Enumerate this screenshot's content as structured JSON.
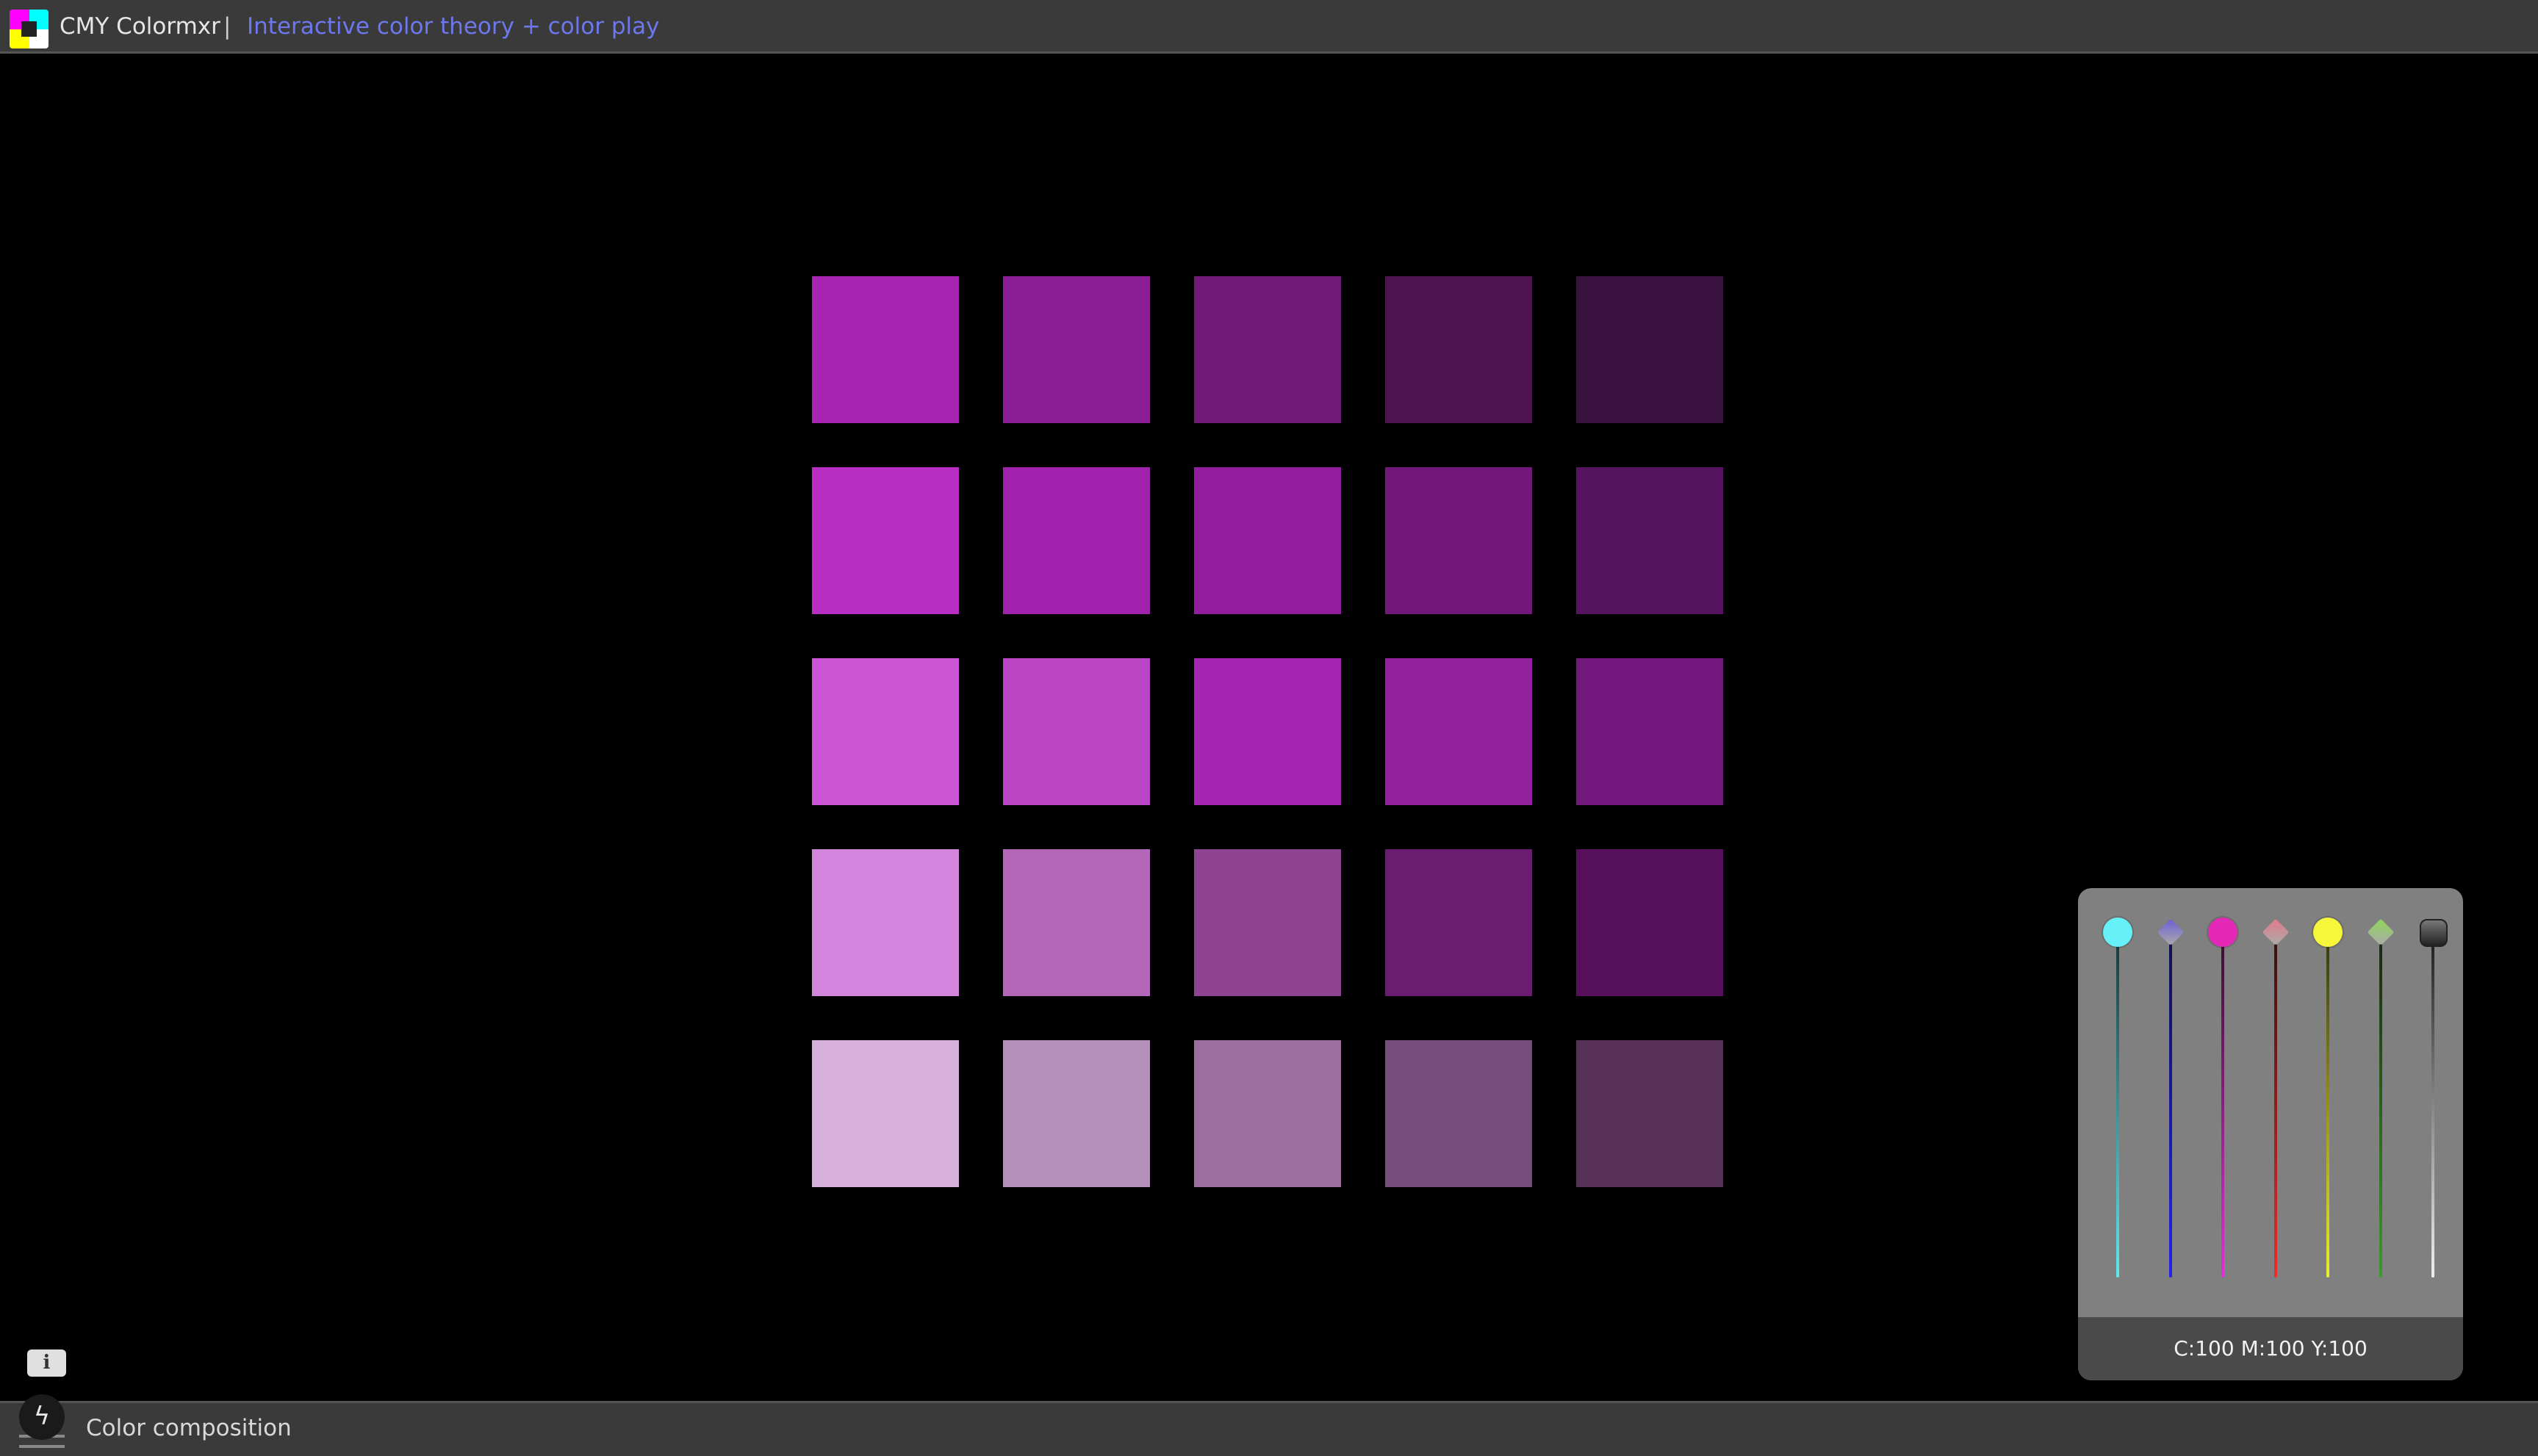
{
  "header": {
    "app_title": "CMY Colormxr",
    "separator": "|",
    "subtitle": "Interactive color theory + color play"
  },
  "swatch_grid": {
    "rows": [
      [
        "#a824b3",
        "#8b1e94",
        "#711a78",
        "#4e1350",
        "#3a1240"
      ],
      [
        "#b82ec2",
        "#a021ac",
        "#921d9f",
        "#72187a",
        "#561460"
      ],
      [
        "#cc55d5",
        "#bb46c5",
        "#a527b1",
        "#93219f",
        "#73187c"
      ],
      [
        "#d385dd",
        "#b466b9",
        "#8e4393",
        "#6a1d70",
        "#560f5b"
      ],
      [
        "#d8b0dc",
        "#b48fba",
        "#9a6e9e",
        "#754d7a",
        "#583159"
      ]
    ]
  },
  "mixer": {
    "sliders": [
      {
        "name": "cyan",
        "knob": "circle",
        "knob_color": "#66f0f8",
        "track_top": "#1a3a3c",
        "track_bottom": "#5fe8ee"
      },
      {
        "name": "blue",
        "knob": "diamond",
        "knob_color": "#6c5fd4",
        "track_top": "#101050",
        "track_bottom": "#2222ee"
      },
      {
        "name": "magenta",
        "knob": "circle",
        "knob_color": "#e429b8",
        "track_top": "#3a1030",
        "track_bottom": "#e22fd8"
      },
      {
        "name": "red",
        "knob": "diamond",
        "knob_color": "#e27a8a",
        "track_top": "#3a1010",
        "track_bottom": "#ee2a2a"
      },
      {
        "name": "yellow",
        "knob": "circle",
        "knob_color": "#f6f63a",
        "track_top": "#3a3a10",
        "track_bottom": "#eeee2a"
      },
      {
        "name": "green",
        "knob": "diamond",
        "knob_color": "#8fd65a",
        "track_top": "#1a2a10",
        "track_bottom": "#3a9a2a"
      },
      {
        "name": "black",
        "knob": "square",
        "knob_color": "#444444",
        "track_top": "#222222",
        "track_bottom": "#f0f0f0"
      }
    ],
    "readout": "C:100 M:100 Y:100"
  },
  "footer": {
    "info_label": "i",
    "bolt_label": "ϟ",
    "label": "Color composition"
  }
}
